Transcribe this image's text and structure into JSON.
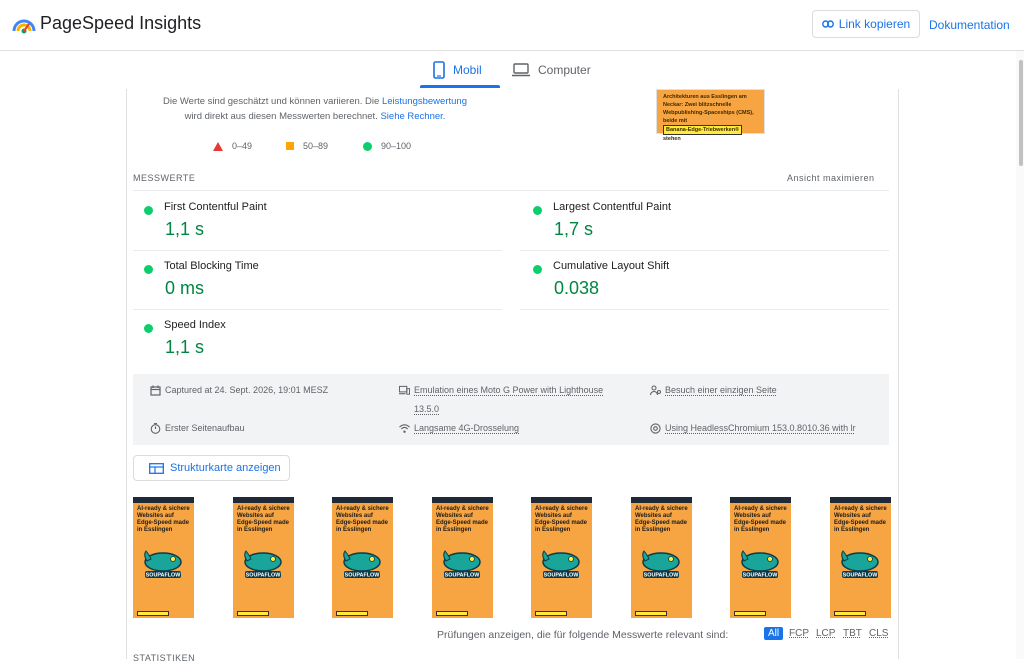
{
  "header": {
    "app_title": "PageSpeed Insights",
    "copy_link_label": "Link kopieren",
    "docs_label": "Dokumentation"
  },
  "tabs": [
    {
      "label": "Mobil",
      "active": true,
      "icon": "smartphone-icon"
    },
    {
      "label": "Computer",
      "active": false,
      "icon": "laptop-icon"
    }
  ],
  "info": {
    "text1": "Die Werte sind geschätzt und können variieren. Die ",
    "link1": "Leistungsbewertung",
    "text2": "wird direkt aus diesen Messwerten berechnet. ",
    "link2": "Siehe Rechner."
  },
  "legend": [
    {
      "range": "0–49",
      "shape": "triangle",
      "color": "#e53935"
    },
    {
      "range": "50–89",
      "shape": "square",
      "color": "#ffa400"
    },
    {
      "range": "90–100",
      "shape": "circle",
      "color": "#0cce6b"
    }
  ],
  "preview": {
    "line1": "Architekturen aus Esslingen am",
    "line2": "Neckar: Zwei blitzschnelle",
    "line3": "Webpublishing-Spaceships (CMS),",
    "line4": "beide mit",
    "highlight": "Banana-Edge-Triebwerken®",
    "after": " stehen"
  },
  "metrics_section": {
    "title": "MESSWERTE",
    "expand_label": "Ansicht maximieren",
    "metrics": [
      {
        "label": "First Contentful Paint",
        "value": "1,1 s",
        "status": "good"
      },
      {
        "label": "Largest Contentful Paint",
        "value": "1,7 s",
        "status": "good"
      },
      {
        "label": "Total Blocking Time",
        "value": "0 ms",
        "status": "good"
      },
      {
        "label": "Cumulative Layout Shift",
        "value": "0.038",
        "status": "good"
      },
      {
        "label": "Speed Index",
        "value": "1,1 s",
        "status": "good"
      }
    ],
    "good_color": "#0cce6b",
    "value_color": "#018642"
  },
  "runtime": {
    "captured": "Captured at 24. Sept. 2026, 19:01 MESZ",
    "emulation": "Emulation eines Moto G Power with Lighthouse",
    "emulation_version": "13.5.0",
    "session": "Besuch einer einzigen Seite",
    "load": "Erster Seitenaufbau",
    "throttling": "Langsame 4G-Drosselung",
    "browser": "Using HeadlessChromium 153.0.8010.36 with lr"
  },
  "treemap_label": "Strukturkarte anzeigen",
  "filmstrip": {
    "frame_count": 8,
    "headline": "AI-ready & sichere Websites auf Edge-Speed made in Esslingen",
    "logo_text": "SOUPAFLOW"
  },
  "audits": {
    "label": "Prüfungen anzeigen, die für folgende Messwerte relevant sind:",
    "filters": [
      "All",
      "FCP",
      "LCP",
      "TBT",
      "CLS"
    ],
    "active": "All"
  },
  "stats_title": "STATISTIKEN",
  "colors": {
    "accent": "#1a73e8",
    "thumb_bg": "#f7a543"
  }
}
